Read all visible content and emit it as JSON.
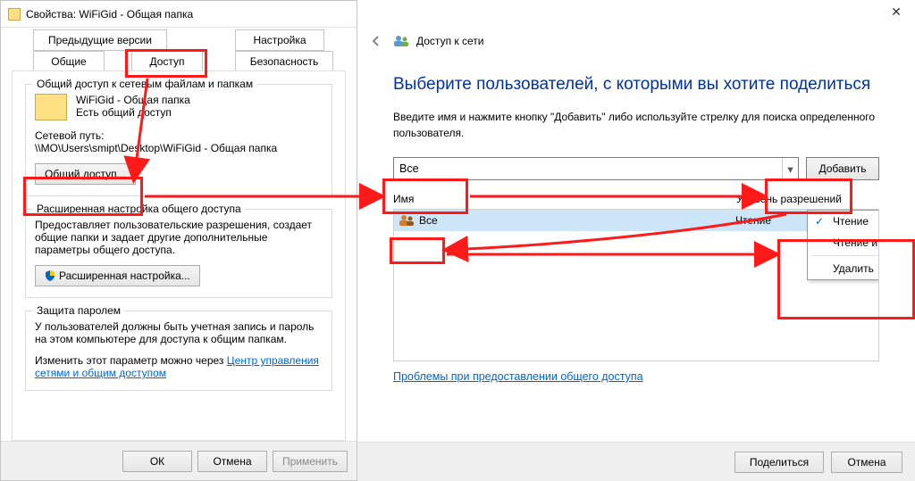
{
  "prop": {
    "title": "Свойства: WiFiGid - Общая папка",
    "tabs": {
      "prev": "Предыдущие версии",
      "settings": "Настройка",
      "general": "Общие",
      "access": "Доступ",
      "security": "Безопасность"
    },
    "group_share": {
      "legend": "Общий доступ к сетевым файлам и папкам",
      "folder_name": "WiFiGid - Общая папка",
      "status": "Есть общий доступ",
      "netpath_label": "Сетевой путь:",
      "netpath_value": "\\\\MO\\Users\\smipt\\Desktop\\WiFiGid - Общая папка",
      "share_button": "Общий доступ..."
    },
    "group_adv": {
      "legend": "Расширенная настройка общего доступа",
      "text": "Предоставляет пользовательские разрешения, создает общие папки и задает другие дополнительные параметры общего доступа.",
      "button": "Расширенная настройка..."
    },
    "group_pw": {
      "legend": "Защита паролем",
      "text": "У пользователей должны быть учетная запись и пароль на этом компьютере для доступа к общим папкам.",
      "change_prefix": "Изменить этот параметр можно через ",
      "change_link": "Центр управления сетями и общим доступом"
    },
    "footer": {
      "ok": "ОК",
      "cancel": "Отмена",
      "apply": "Применить"
    }
  },
  "share": {
    "nav_label": "Доступ к сети",
    "heading": "Выберите пользователей, с которыми вы хотите поделиться",
    "instruction": "Введите имя и нажмите кнопку \"Добавить\" либо используйте стрелку для поиска определенного пользователя.",
    "combo_value": "Все",
    "add_button": "Добавить",
    "col_name": "Имя",
    "col_level": "Уровень разрешений",
    "row_user": "Все",
    "row_level": "Чтение",
    "menu": {
      "read": "Чтение",
      "readwrite": "Чтение и запись",
      "delete": "Удалить"
    },
    "trouble_link": "Проблемы при предоставлении общего доступа",
    "footer": {
      "share": "Поделиться",
      "cancel": "Отмена"
    }
  }
}
